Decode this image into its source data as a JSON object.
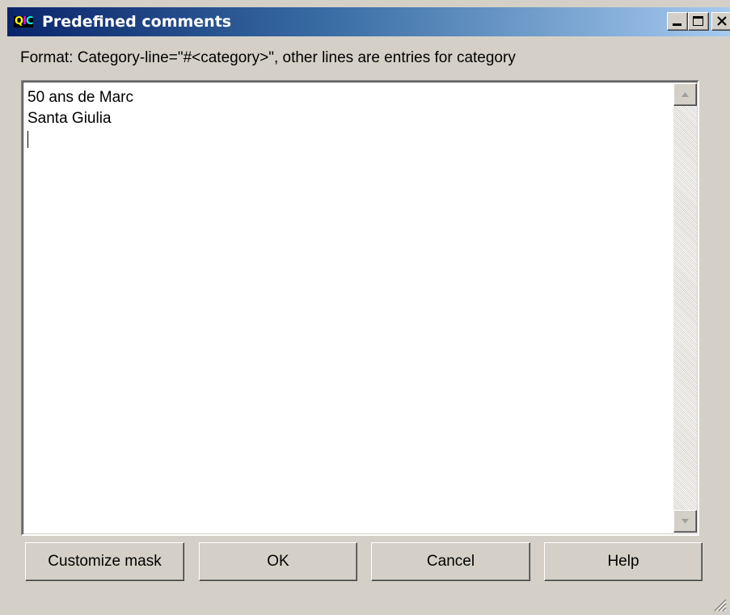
{
  "window": {
    "app_icon": {
      "q": "Q",
      "i": "I",
      "c": "C"
    },
    "title": "Predefined comments",
    "controls": {
      "minimize_icon": "minimize-icon",
      "maximize_icon": "maximize-icon",
      "close_icon": "close-icon"
    }
  },
  "format_label": "Format: Category-line=\"#<category>\", other lines are entries for category",
  "editor": {
    "lines": [
      "50 ans de Marc",
      "Santa Giulia"
    ],
    "caret_visible": true
  },
  "buttons": {
    "customize_mask": "Customize mask",
    "ok": "OK",
    "cancel": "Cancel",
    "help": "Help"
  },
  "colors": {
    "titlebar_start": "#0a246a",
    "titlebar_end": "#a6caf0",
    "face": "#d4d0c8"
  }
}
